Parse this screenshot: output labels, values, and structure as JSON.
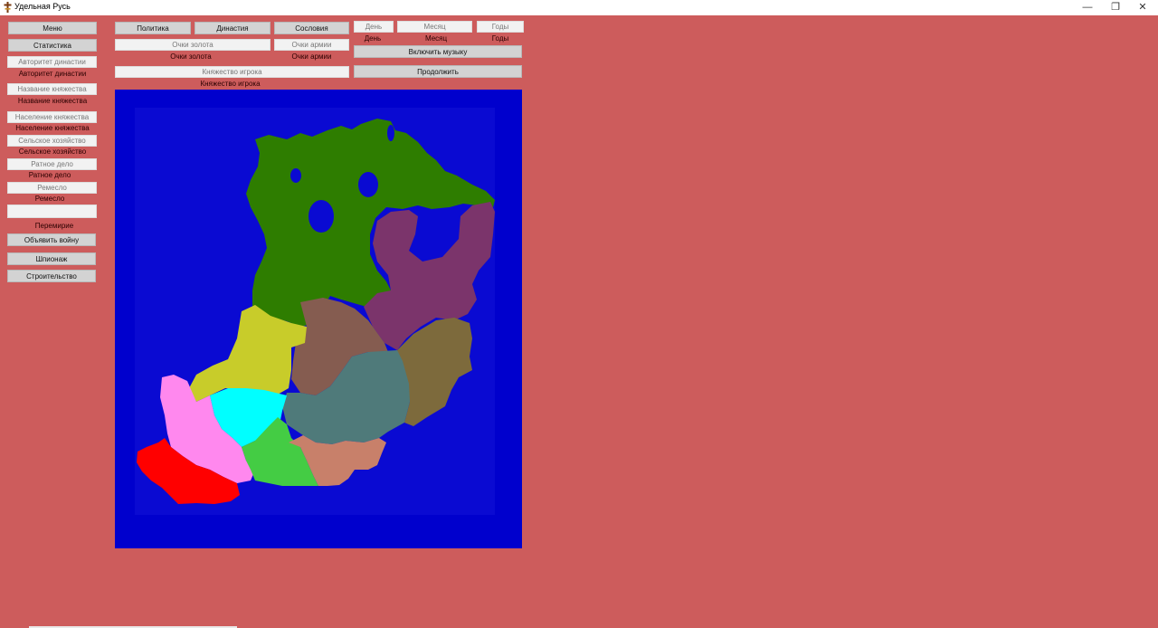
{
  "window": {
    "title": "Удельная Русь",
    "minimize": "—",
    "restore": "❐",
    "close": "✕"
  },
  "sidebar": {
    "menu": "Меню",
    "stats": "Статистика",
    "dynasty_authority_field": "Авторитет династии",
    "dynasty_authority_label": "Авторитет династии",
    "principality_name_field": "Название княжества",
    "principality_name_label": "Название княжества",
    "population_field": "Население княжества",
    "population_label": "Население княжества",
    "agriculture_field": "Сельское хозяйство",
    "agriculture_label": "Сельское хозяйство",
    "military_field": "Ратное дело",
    "military_label": "Ратное дело",
    "craft_field": "Ремесло",
    "craft_label": "Ремесло",
    "empty_field": "",
    "truce_label": "Перемирие",
    "declare_war": "Объявить войну",
    "espionage": "Шпионаж",
    "construction": "Строительство"
  },
  "top": {
    "politics": "Политика",
    "dynasty": "Династия",
    "estates": "Сословия",
    "gold_field": "Очки золота",
    "gold_label": "Очки золота",
    "army_field": "Очки армии",
    "army_label": "Очки армии",
    "player_principality_field": "Княжество игрока",
    "player_principality_label": "Княжество игрока",
    "day_field": "День",
    "month_field": "Месяц",
    "years_field": "Годы",
    "day_label": "День",
    "month_label": "Месяц",
    "years_label": "Годы",
    "music": "Включить музыку",
    "continue": "Продолжить"
  },
  "map": {
    "sea_color": "#0000cd",
    "regions": [
      {
        "id": "north",
        "color": "#2e7d00"
      },
      {
        "id": "northeast",
        "color": "#7b346b"
      },
      {
        "id": "center-brown",
        "color": "#855c50"
      },
      {
        "id": "east-olive",
        "color": "#7d6a3c"
      },
      {
        "id": "yellow",
        "color": "#c8cc2a"
      },
      {
        "id": "teal",
        "color": "#4f7a7a"
      },
      {
        "id": "cyan",
        "color": "#00ffff"
      },
      {
        "id": "pink",
        "color": "#ff88ee"
      },
      {
        "id": "green",
        "color": "#44cc44"
      },
      {
        "id": "salmon",
        "color": "#c8806a"
      },
      {
        "id": "red",
        "color": "#ff0000"
      }
    ]
  }
}
